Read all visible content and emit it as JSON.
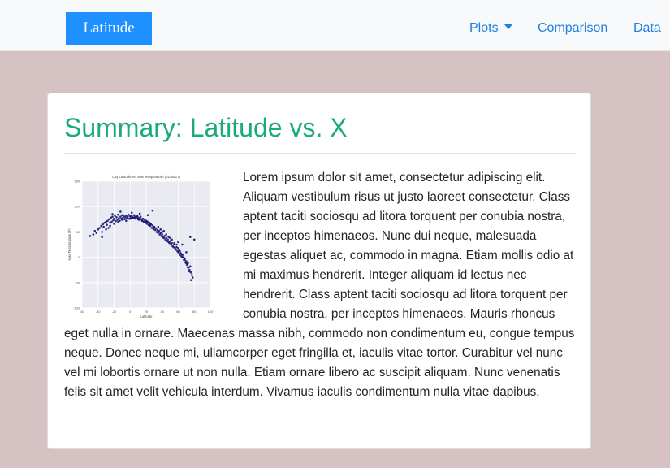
{
  "navbar": {
    "brand": "Latitude",
    "links": [
      {
        "label": "Plots",
        "has_dropdown": true
      },
      {
        "label": "Comparison"
      },
      {
        "label": "Data"
      }
    ]
  },
  "summary": {
    "title": "Summary: Latitude vs. X",
    "paragraph": "Lorem ipsum dolor sit amet, consectetur adipiscing elit. Aliquam vestibulum risus ut justo laoreet consectetur. Class aptent taciti sociosqu ad litora torquent per conubia nostra, per inceptos himenaeos. Nunc dui neque, malesuada egestas aliquet ac, commodo in magna. Etiam mollis odio at mi maximus hendrerit. Integer aliquam id lectus nec hendrerit. Class aptent taciti sociosqu ad litora torquent per conubia nostra, per inceptos himenaeos. Mauris rhoncus eget nulla in ornare. Maecenas massa nibh, commodo non condimentum eu, congue tempus neque. Donec neque mi, ullamcorper eget fringilla et, iaculis vitae tortor. Curabitur vel nunc vel mi lobortis ornare ut non nulla. Etiam ornare libero ac suscipit aliquam. Nunc venenatis felis sit amet velit vehicula interdum. Vivamus iaculis condimentum nulla vitae dapibus."
  },
  "colors": {
    "brand_bg": "#1e90ff",
    "link": "#1e7fe0",
    "title": "#1aaa7e",
    "page_bg": "#d6c2c2",
    "point": "#14146e"
  },
  "chart_data": {
    "type": "scatter",
    "title": "City Latitude vs. Max Temperature (01/05/17)",
    "xlabel": "Latitude",
    "ylabel": "Max Temperature (F)",
    "xlim": [
      -60,
      100
    ],
    "ylim": [
      -100,
      150
    ],
    "xticks": [
      -60,
      -40,
      -20,
      0,
      20,
      40,
      60,
      80,
      100
    ],
    "yticks": [
      -100,
      -50,
      0,
      50,
      100,
      150
    ],
    "grid": true,
    "series": [
      {
        "x": [
          -50,
          -46,
          -44,
          -42,
          -40,
          -38,
          -36,
          -35,
          -34,
          -33,
          -32,
          -30,
          -29,
          -28,
          -27,
          -26,
          -25,
          -24,
          -23,
          -22,
          -21,
          -20,
          -19,
          -18,
          -17,
          -16,
          -15,
          -14,
          -13,
          -12,
          -11,
          -10,
          -9,
          -8,
          -7,
          -6,
          -5,
          -4,
          -3,
          -2,
          -1,
          0,
          1,
          2,
          3,
          4,
          5,
          6,
          7,
          8,
          9,
          10,
          11,
          12,
          13,
          14,
          15,
          16,
          17,
          18,
          19,
          20,
          21,
          22,
          23,
          24,
          25,
          26,
          27,
          28,
          29,
          30,
          31,
          32,
          33,
          34,
          35,
          36,
          37,
          38,
          39,
          40,
          41,
          42,
          43,
          44,
          45,
          46,
          47,
          48,
          49,
          50,
          51,
          52,
          53,
          54,
          55,
          56,
          57,
          58,
          59,
          60,
          61,
          62,
          63,
          64,
          65,
          66,
          67,
          68,
          69,
          70,
          71,
          72,
          73,
          74,
          75,
          76,
          77,
          78,
          35,
          38,
          40,
          42,
          45,
          48,
          50,
          52,
          55,
          58,
          60,
          62,
          64,
          66,
          68,
          70,
          72,
          74,
          76,
          -30,
          -25,
          -20,
          -15,
          -10,
          -5,
          0,
          5,
          10,
          15,
          20,
          25,
          30,
          -35,
          -22,
          -12,
          2,
          12,
          22,
          28,
          60,
          65,
          70,
          75,
          80
        ],
        "y": [
          42,
          45,
          52,
          48,
          55,
          58,
          62,
          50,
          65,
          60,
          68,
          70,
          64,
          72,
          58,
          75,
          68,
          78,
          70,
          80,
          73,
          76,
          82,
          71,
          79,
          74,
          84,
          77,
          72,
          80,
          76,
          83,
          78,
          81,
          75,
          79,
          82,
          77,
          80,
          84,
          76,
          81,
          78,
          82,
          79,
          77,
          83,
          80,
          76,
          79,
          81,
          78,
          74,
          77,
          80,
          75,
          72,
          76,
          70,
          74,
          68,
          72,
          66,
          70,
          64,
          68,
          62,
          65,
          58,
          63,
          56,
          60,
          54,
          57,
          50,
          54,
          48,
          52,
          45,
          48,
          42,
          45,
          40,
          38,
          42,
          35,
          38,
          32,
          35,
          30,
          28,
          32,
          25,
          28,
          22,
          20,
          25,
          18,
          15,
          20,
          12,
          10,
          15,
          5,
          8,
          2,
          0,
          5,
          -5,
          -2,
          -10,
          -8,
          -15,
          -12,
          -20,
          -25,
          -18,
          -30,
          -35,
          -40,
          60,
          55,
          50,
          52,
          45,
          40,
          38,
          35,
          28,
          25,
          18,
          12,
          6,
          0,
          -5,
          -12,
          -20,
          -28,
          -45,
          55,
          62,
          66,
          70,
          74,
          72,
          76,
          78,
          75,
          72,
          70,
          65,
          60,
          40,
          85,
          90,
          88,
          86,
          83,
          92,
          30,
          25,
          10,
          40,
          35
        ]
      }
    ]
  }
}
